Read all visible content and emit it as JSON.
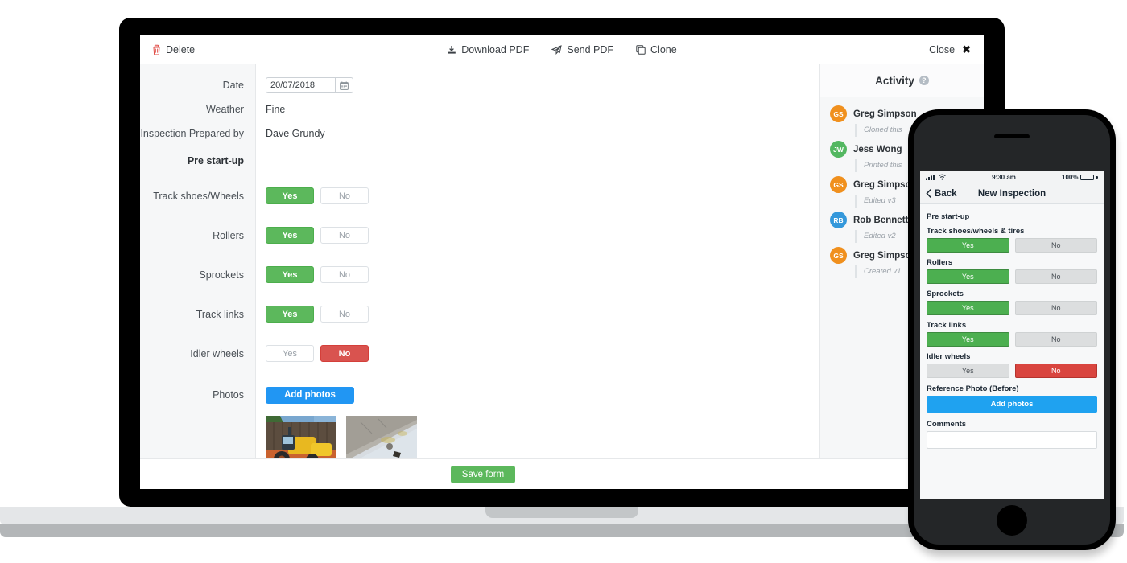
{
  "toolbar": {
    "delete_label": "Delete",
    "download_label": "Download PDF",
    "send_label": "Send PDF",
    "clone_label": "Clone",
    "close_label": "Close"
  },
  "form": {
    "rows": [
      {
        "label": "Date",
        "type": "date",
        "value": "20/07/2018"
      },
      {
        "label": "Weather",
        "type": "text",
        "value": "Fine"
      },
      {
        "label": "Inspection Prepared by",
        "type": "text",
        "value": "Dave Grundy"
      },
      {
        "label": "Pre start-up",
        "type": "header",
        "value": ""
      },
      {
        "label": "Track shoes/Wheels",
        "type": "yesno",
        "yes": "Yes",
        "no": "No",
        "selected": "yes"
      },
      {
        "label": "Rollers",
        "type": "yesno",
        "yes": "Yes",
        "no": "No",
        "selected": "yes"
      },
      {
        "label": "Sprockets",
        "type": "yesno",
        "yes": "Yes",
        "no": "No",
        "selected": "yes"
      },
      {
        "label": "Track links",
        "type": "yesno",
        "yes": "Yes",
        "no": "No",
        "selected": "yes"
      },
      {
        "label": "Idler wheels",
        "type": "yesno",
        "yes": "Yes",
        "no": "No",
        "selected": "no"
      },
      {
        "label": "Photos",
        "type": "photos",
        "button": "Add photos"
      }
    ]
  },
  "footer": {
    "save_label": "Save form"
  },
  "activity": {
    "title": "Activity",
    "help_glyph": "?",
    "items": [
      {
        "initials": "GS",
        "name": "Greg Simpson",
        "action": "Cloned this",
        "color": "#f0901e"
      },
      {
        "initials": "JW",
        "name": "Jess Wong",
        "action": "Printed this",
        "color": "#53b761"
      },
      {
        "initials": "GS",
        "name": "Greg Simpson",
        "action": "Edited v3",
        "color": "#f0901e"
      },
      {
        "initials": "RB",
        "name": "Rob Bennetts",
        "action": "Edited v2",
        "color": "#3498db"
      },
      {
        "initials": "GS",
        "name": "Greg Simpson",
        "action": "Created v1",
        "color": "#f0901e"
      }
    ]
  },
  "phone": {
    "status": {
      "time": "9:30 am",
      "battery": "100%"
    },
    "nav": {
      "back": "Back",
      "title": "New Inspection"
    },
    "section": "Pre start-up",
    "rows": [
      {
        "label": "Track shoes/wheels & tires",
        "yes": "Yes",
        "no": "No",
        "selected": "yes"
      },
      {
        "label": "Rollers",
        "yes": "Yes",
        "no": "No",
        "selected": "yes"
      },
      {
        "label": "Sprockets",
        "yes": "Yes",
        "no": "No",
        "selected": "yes"
      },
      {
        "label": "Track links",
        "yes": "Yes",
        "no": "No",
        "selected": "yes"
      },
      {
        "label": "Idler wheels",
        "yes": "Yes",
        "no": "No",
        "selected": "no"
      }
    ],
    "photo_label": "Reference Photo (Before)",
    "add_photos": "Add photos",
    "comments_label": "Comments",
    "comments_value": ""
  },
  "colors": {
    "green": "#5cb85c",
    "red": "#d9534f",
    "blue": "#2196f3",
    "delete_red": "#e04b45"
  }
}
